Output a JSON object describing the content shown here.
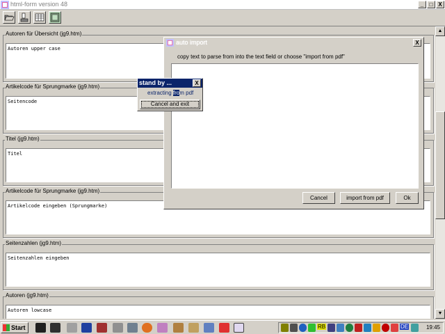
{
  "window": {
    "title": "html-form version 48",
    "controls": [
      "_",
      "□",
      "X"
    ]
  },
  "toolbar": {
    "buttons": [
      {
        "name": "open-folder-icon"
      },
      {
        "name": "export-icon"
      },
      {
        "name": "table-icon"
      },
      {
        "name": "image-frame-icon"
      }
    ]
  },
  "fields": [
    {
      "label": "Autoren für Übersicht (jg9.htm)",
      "value": "Autoren upper case"
    },
    {
      "label": "Artikelcode für Sprungmarke (jg9.htm)",
      "value": "Seitencode"
    },
    {
      "label": "Titel (jg9.htm)",
      "value": "Titel"
    },
    {
      "label": "Artikelcode für Sprungmarke (jg9.htm)",
      "value": "Artikelcode eingeben (Sprungmarke)"
    },
    {
      "label": "Seitenzahlen (jg9.htm)",
      "value": "Seitenzahlen eingeben"
    },
    {
      "label": "Autoren (jg9.htm)",
      "value": "Autoren lowcase"
    }
  ],
  "auto_import": {
    "title": "auto import",
    "close": "X",
    "message": "copy text to parse from into the text field or choose \"import from pdf\"",
    "text_value": "",
    "buttons": {
      "cancel": "Cancel",
      "import": "import from pdf",
      "ok": "Ok"
    }
  },
  "standby": {
    "title": "stand by ...",
    "close": "X",
    "text_before": "extracting ",
    "text_selected": "fro",
    "text_after": "m pdf",
    "button": "Cancel and exit"
  },
  "taskbar": {
    "start_label": "Start",
    "clock": "19:45",
    "tray_labels": [
      "RB",
      "DE"
    ]
  },
  "colors": {
    "dialog_title_active": "#0a246a",
    "face": "#d4d0c8"
  }
}
